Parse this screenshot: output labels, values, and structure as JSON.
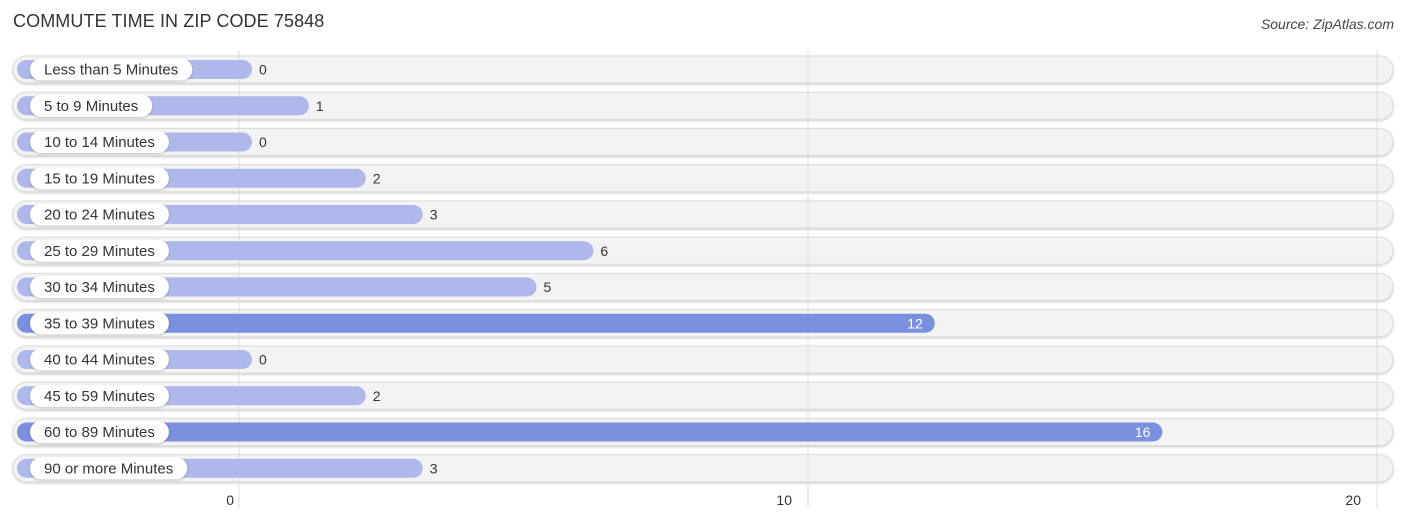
{
  "header": {
    "title": "COMMUTE TIME IN ZIP CODE 75848",
    "source": "Source: ZipAtlas.com"
  },
  "chart_data": {
    "type": "bar",
    "orientation": "horizontal",
    "title": "COMMUTE TIME IN ZIP CODE 75848",
    "xlabel": "",
    "ylabel": "",
    "categories": [
      "Less than 5 Minutes",
      "5 to 9 Minutes",
      "10 to 14 Minutes",
      "15 to 19 Minutes",
      "20 to 24 Minutes",
      "25 to 29 Minutes",
      "30 to 34 Minutes",
      "35 to 39 Minutes",
      "40 to 44 Minutes",
      "45 to 59 Minutes",
      "60 to 89 Minutes",
      "90 or more Minutes"
    ],
    "values": [
      0,
      1,
      0,
      2,
      3,
      6,
      5,
      12,
      0,
      2,
      16,
      3
    ],
    "xlim": [
      0,
      20
    ],
    "xticks": [
      0,
      10,
      20
    ],
    "grid": true,
    "colors": {
      "bar_light": "#aeb8ea",
      "bar_dark": "#7b8fdf",
      "track": "#f3f3f3",
      "grid": "#dddddd"
    }
  }
}
